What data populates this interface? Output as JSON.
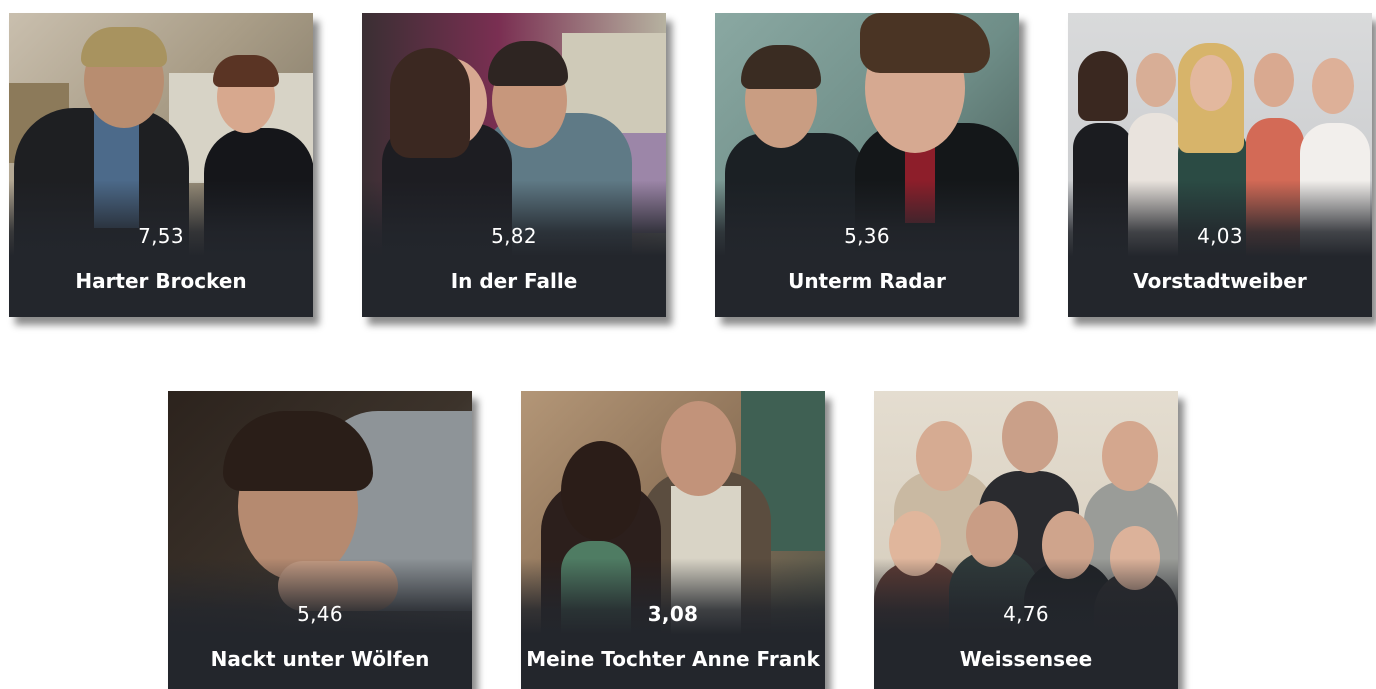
{
  "cards": [
    {
      "score": "7,53",
      "title": "Harter Brocken"
    },
    {
      "score": "5,82",
      "title": "In der Falle"
    },
    {
      "score": "5,36",
      "title": "Unterm Radar"
    },
    {
      "score": "4,03",
      "title": "Vorstadtweiber"
    },
    {
      "score": "5,46",
      "title": "Nackt unter Wölfen"
    },
    {
      "score": "3,08",
      "title": "Meine Tochter Anne Frank"
    },
    {
      "score": "4,76",
      "title": "Weissensee"
    }
  ]
}
